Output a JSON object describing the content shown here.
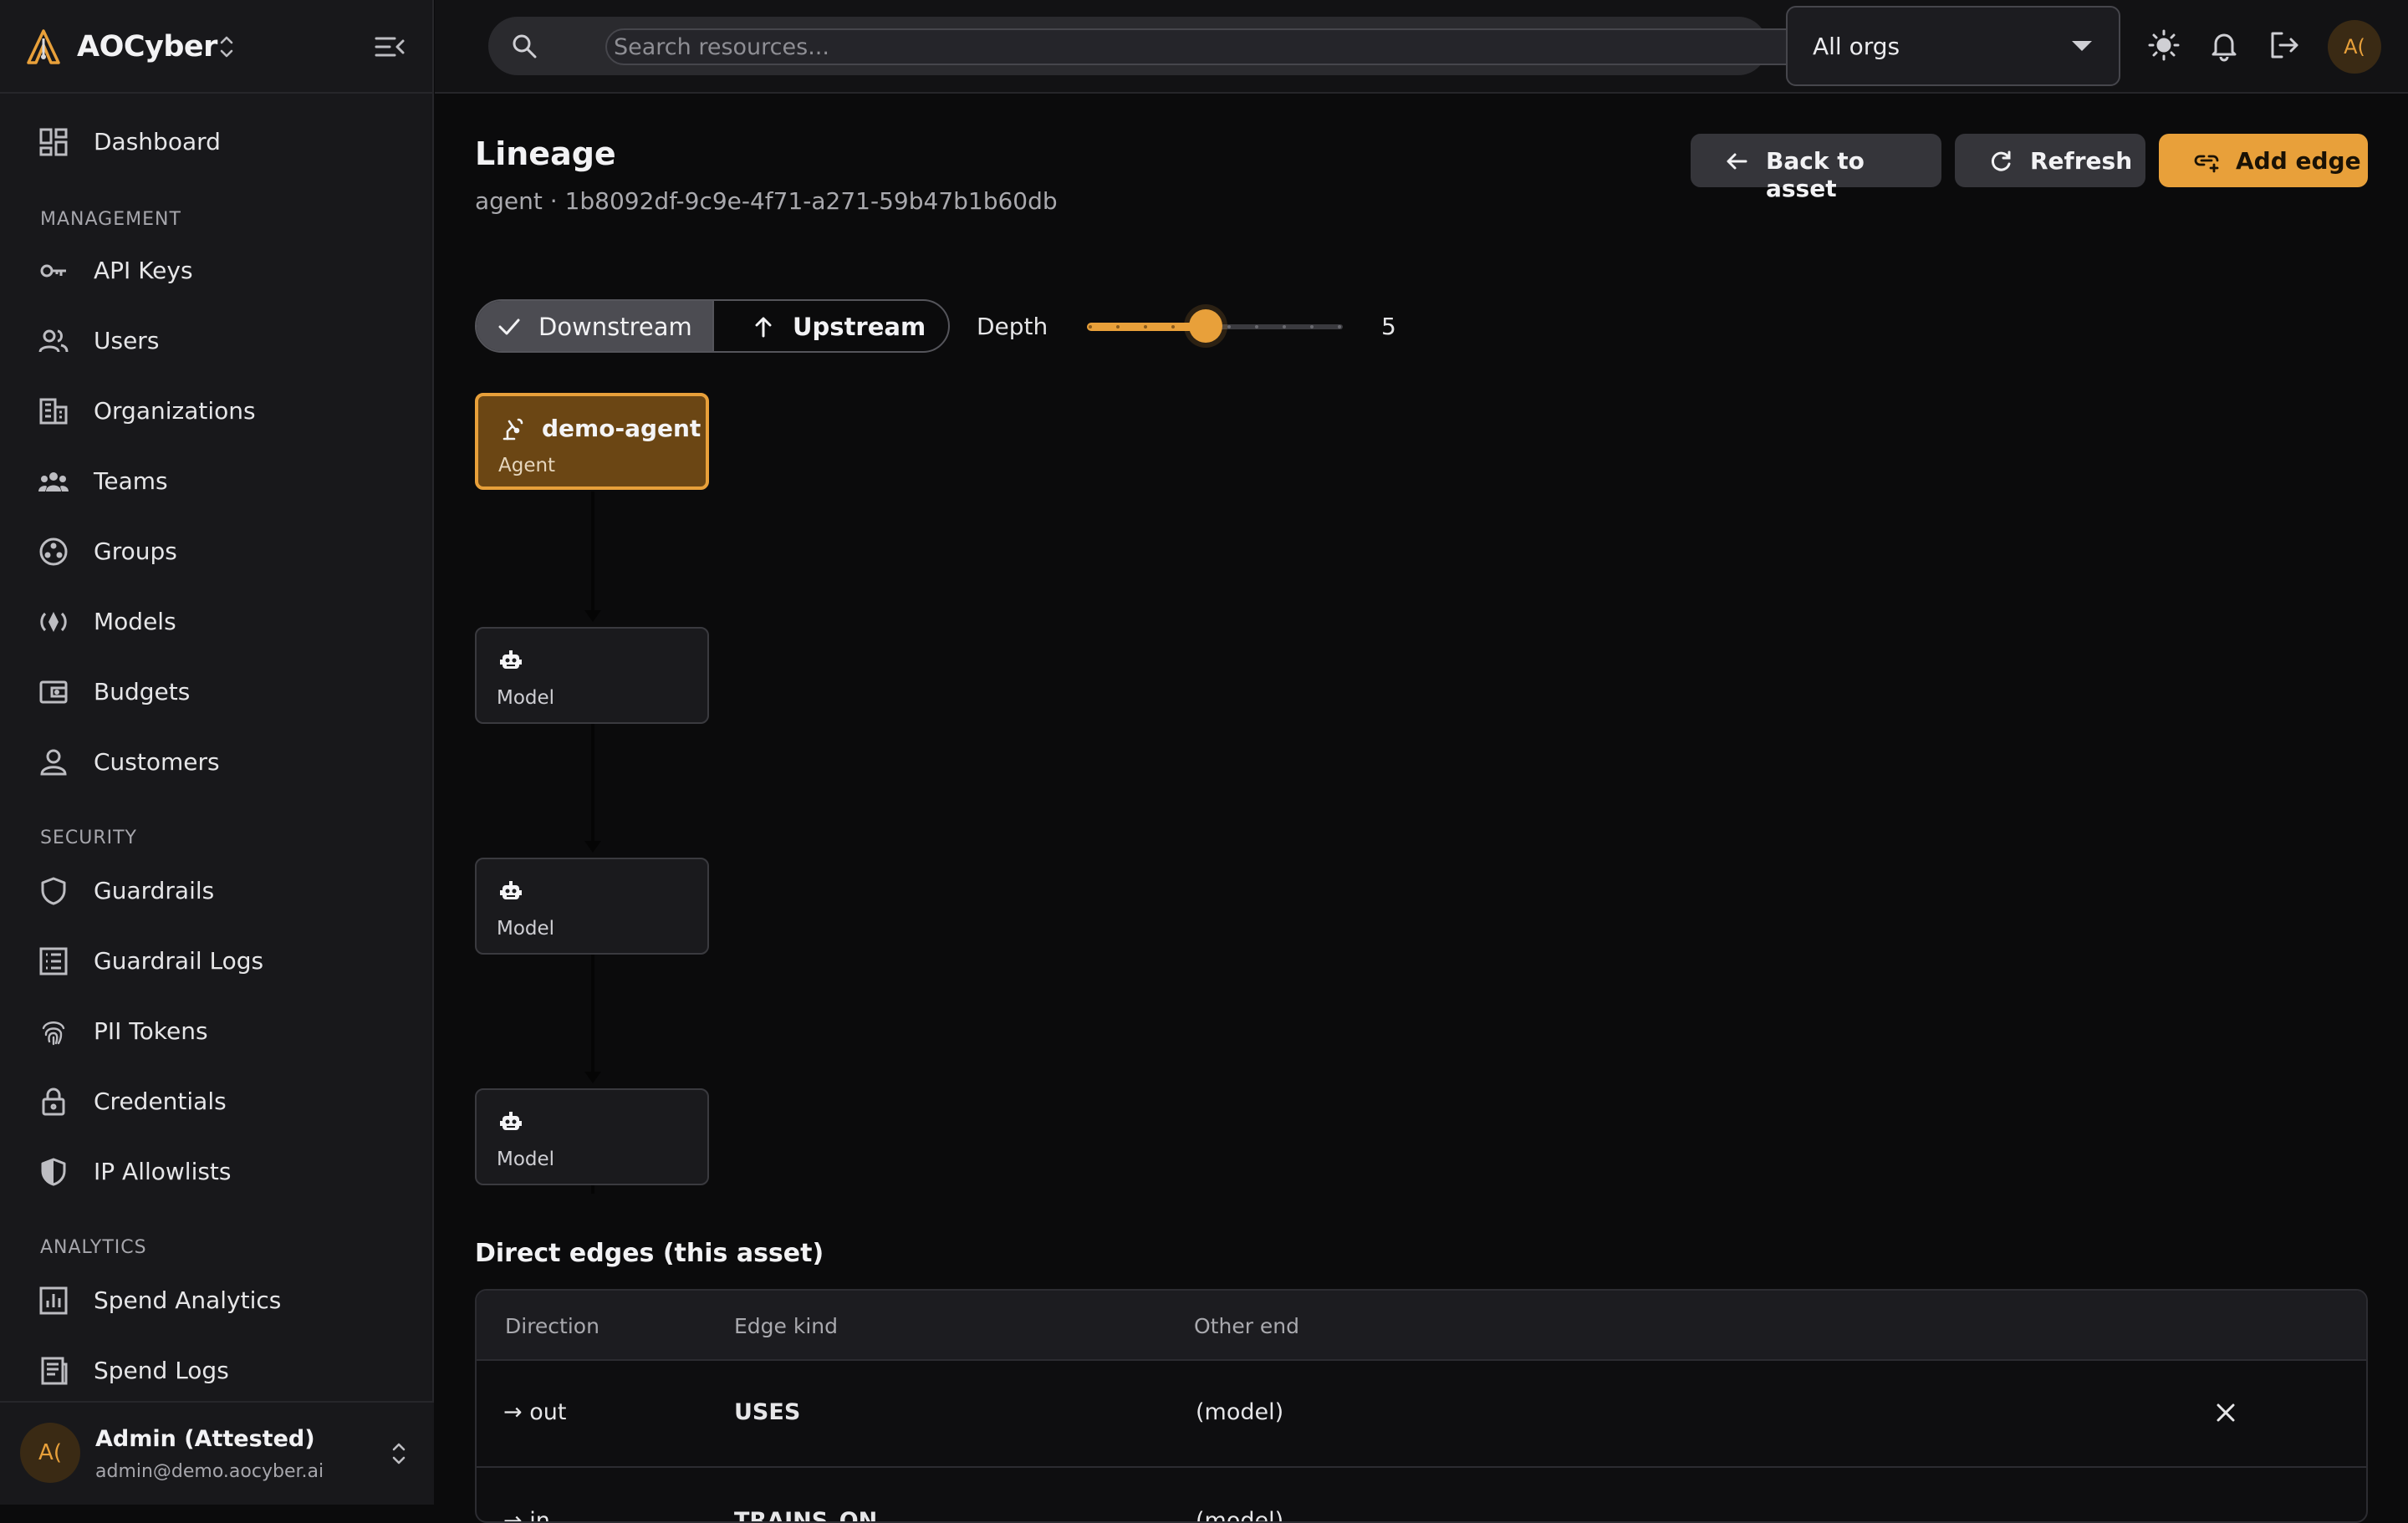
{
  "app": {
    "name": "AOCyber"
  },
  "sidebar": {
    "items_top": [
      {
        "label": "Dashboard",
        "icon": "dashboard-icon"
      }
    ],
    "sections": [
      {
        "label": "MANAGEMENT",
        "items": [
          {
            "label": "API Keys",
            "icon": "key-icon"
          },
          {
            "label": "Users",
            "icon": "users-icon"
          },
          {
            "label": "Organizations",
            "icon": "building-icon"
          },
          {
            "label": "Teams",
            "icon": "teams-icon"
          },
          {
            "label": "Groups",
            "icon": "groups-icon"
          },
          {
            "label": "Models",
            "icon": "models-icon"
          },
          {
            "label": "Budgets",
            "icon": "wallet-icon"
          },
          {
            "label": "Customers",
            "icon": "person-icon"
          }
        ]
      },
      {
        "label": "SECURITY",
        "items": [
          {
            "label": "Guardrails",
            "icon": "shield-icon"
          },
          {
            "label": "Guardrail Logs",
            "icon": "list-icon"
          },
          {
            "label": "PII Tokens",
            "icon": "fingerprint-icon"
          },
          {
            "label": "Credentials",
            "icon": "lock-icon"
          },
          {
            "label": "IP Allowlists",
            "icon": "shield-half-icon"
          }
        ]
      },
      {
        "label": "ANALYTICS",
        "items": [
          {
            "label": "Spend Analytics",
            "icon": "chart-icon"
          },
          {
            "label": "Spend Logs",
            "icon": "receipt-icon"
          }
        ]
      }
    ],
    "user": {
      "initials": "A(",
      "name": "Admin (Attested)",
      "email": "admin@demo.aocyber.ai"
    }
  },
  "topbar": {
    "search_placeholder": "Search resources...",
    "org_select": "All orgs",
    "avatar_initials": "A("
  },
  "page": {
    "title": "Lineage",
    "subtitle": "agent · 1b8092df-9c9e-4f71-a271-59b47b1b60db",
    "buttons": {
      "back": "Back to asset",
      "refresh": "Refresh",
      "add_edge": "Add edge"
    },
    "direction": {
      "downstream": "Downstream",
      "upstream": "Upstream",
      "selected": "downstream"
    },
    "depth": {
      "label": "Depth",
      "value": 5,
      "min": 1,
      "max": 10
    }
  },
  "graph": {
    "nodes": [
      {
        "name": "demo-agent",
        "kind": "Agent",
        "icon": "agent-icon",
        "root": true
      },
      {
        "name": "",
        "kind": "Model",
        "icon": "robot-icon",
        "root": false
      },
      {
        "name": "",
        "kind": "Model",
        "icon": "robot-icon",
        "root": false
      },
      {
        "name": "",
        "kind": "Model",
        "icon": "robot-icon",
        "root": false
      }
    ]
  },
  "edges_table": {
    "title": "Direct edges (this asset)",
    "columns": [
      "Direction",
      "Edge kind",
      "Other end"
    ],
    "rows": [
      {
        "direction": "→ out",
        "kind": "USES",
        "other": "(model)"
      },
      {
        "direction": "→ in",
        "kind": "TRAINS_ON",
        "other": "(model)"
      }
    ]
  },
  "colors": {
    "accent": "#e8a03a",
    "background": "#0b0b0c",
    "sidebar": "#18181b"
  }
}
